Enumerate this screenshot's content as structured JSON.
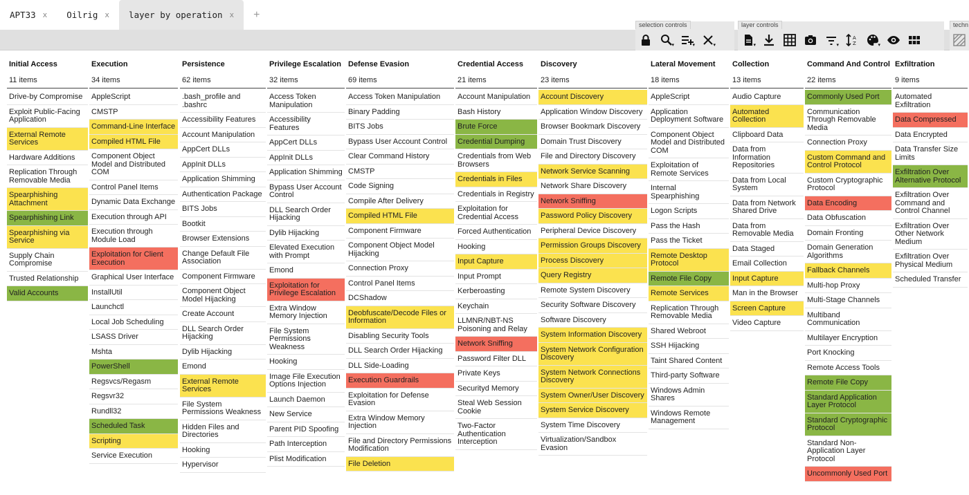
{
  "tabs": [
    {
      "label": "APT33",
      "close": "x"
    },
    {
      "label": "Oilrig",
      "close": "x"
    },
    {
      "label": "layer by operation",
      "close": "x"
    }
  ],
  "tab_add": "+",
  "toolbar": {
    "selection_label": "selection controls",
    "layer_label": "layer controls",
    "technique_label": "techn"
  },
  "colors": {
    "yellow": "#fbe24f",
    "green": "#8ab645",
    "red": "#f46f5f"
  },
  "icons": {
    "selection": [
      "lock-icon",
      "search-icon",
      "select-multiple-icon",
      "clear-icon"
    ],
    "layer": [
      "export-icon",
      "download-icon",
      "grid-icon",
      "camera-icon",
      "filter-icon",
      "sort-icon",
      "palette-icon",
      "eye-icon",
      "view-mode-icon"
    ],
    "technique": [
      "disable-icon"
    ]
  },
  "tactics": [
    {
      "name": "Initial Access",
      "count": "11 items",
      "techniques": [
        [
          "Drive-by Compromise",
          ""
        ],
        [
          "Exploit Public-Facing Application",
          ""
        ],
        [
          "External Remote Services",
          "y"
        ],
        [
          "Hardware Additions",
          ""
        ],
        [
          "Replication Through Removable Media",
          ""
        ],
        [
          "Spearphishing Attachment",
          "y"
        ],
        [
          "Spearphishing Link",
          "g"
        ],
        [
          "Spearphishing via Service",
          "y"
        ],
        [
          "Supply Chain Compromise",
          ""
        ],
        [
          "Trusted Relationship",
          ""
        ],
        [
          "Valid Accounts",
          "g"
        ]
      ]
    },
    {
      "name": "Execution",
      "count": "34 items",
      "techniques": [
        [
          "AppleScript",
          ""
        ],
        [
          "CMSTP",
          ""
        ],
        [
          "Command-Line Interface",
          "y"
        ],
        [
          "Compiled HTML File",
          "y"
        ],
        [
          "Component Object Model and Distributed COM",
          ""
        ],
        [
          "Control Panel Items",
          ""
        ],
        [
          "Dynamic Data Exchange",
          ""
        ],
        [
          "Execution through API",
          ""
        ],
        [
          "Execution through Module Load",
          ""
        ],
        [
          "Exploitation for Client Execution",
          "r"
        ],
        [
          "Graphical User Interface",
          ""
        ],
        [
          "InstallUtil",
          ""
        ],
        [
          "Launchctl",
          ""
        ],
        [
          "Local Job Scheduling",
          ""
        ],
        [
          "LSASS Driver",
          ""
        ],
        [
          "Mshta",
          ""
        ],
        [
          "PowerShell",
          "g"
        ],
        [
          "Regsvcs/Regasm",
          ""
        ],
        [
          "Regsvr32",
          ""
        ],
        [
          "Rundll32",
          ""
        ],
        [
          "Scheduled Task",
          "g"
        ],
        [
          "Scripting",
          "y"
        ],
        [
          "Service Execution",
          ""
        ]
      ]
    },
    {
      "name": "Persistence",
      "count": "62 items",
      "techniques": [
        [
          ".bash_profile and .bashrc",
          ""
        ],
        [
          "Accessibility Features",
          ""
        ],
        [
          "Account Manipulation",
          ""
        ],
        [
          "AppCert DLLs",
          ""
        ],
        [
          "AppInit DLLs",
          ""
        ],
        [
          "Application Shimming",
          ""
        ],
        [
          "Authentication Package",
          ""
        ],
        [
          "BITS Jobs",
          ""
        ],
        [
          "Bootkit",
          ""
        ],
        [
          "Browser Extensions",
          ""
        ],
        [
          "Change Default File Association",
          ""
        ],
        [
          "Component Firmware",
          ""
        ],
        [
          "Component Object Model Hijacking",
          ""
        ],
        [
          "Create Account",
          ""
        ],
        [
          "DLL Search Order Hijacking",
          ""
        ],
        [
          "Dylib Hijacking",
          ""
        ],
        [
          "Emond",
          ""
        ],
        [
          "External Remote Services",
          "y"
        ],
        [
          "File System Permissions Weakness",
          ""
        ],
        [
          "Hidden Files and Directories",
          ""
        ],
        [
          "Hooking",
          ""
        ],
        [
          "Hypervisor",
          ""
        ]
      ]
    },
    {
      "name": "Privilege Escalation",
      "count": "32 items",
      "techniques": [
        [
          "Access Token Manipulation",
          ""
        ],
        [
          "Accessibility Features",
          ""
        ],
        [
          "AppCert DLLs",
          ""
        ],
        [
          "AppInit DLLs",
          ""
        ],
        [
          "Application Shimming",
          ""
        ],
        [
          "Bypass User Account Control",
          ""
        ],
        [
          "DLL Search Order Hijacking",
          ""
        ],
        [
          "Dylib Hijacking",
          ""
        ],
        [
          "Elevated Execution with Prompt",
          ""
        ],
        [
          "Emond",
          ""
        ],
        [
          "Exploitation for Privilege Escalation",
          "r"
        ],
        [
          "Extra Window Memory Injection",
          ""
        ],
        [
          "File System Permissions Weakness",
          ""
        ],
        [
          "Hooking",
          ""
        ],
        [
          "Image File Execution Options Injection",
          ""
        ],
        [
          "Launch Daemon",
          ""
        ],
        [
          "New Service",
          ""
        ],
        [
          "Parent PID Spoofing",
          ""
        ],
        [
          "Path Interception",
          ""
        ],
        [
          "Plist Modification",
          ""
        ]
      ]
    },
    {
      "name": "Defense Evasion",
      "count": "69 items",
      "techniques": [
        [
          "Access Token Manipulation",
          ""
        ],
        [
          "Binary Padding",
          ""
        ],
        [
          "BITS Jobs",
          ""
        ],
        [
          "Bypass User Account Control",
          ""
        ],
        [
          "Clear Command History",
          ""
        ],
        [
          "CMSTP",
          ""
        ],
        [
          "Code Signing",
          ""
        ],
        [
          "Compile After Delivery",
          ""
        ],
        [
          "Compiled HTML File",
          "y"
        ],
        [
          "Component Firmware",
          ""
        ],
        [
          "Component Object Model Hijacking",
          ""
        ],
        [
          "Connection Proxy",
          ""
        ],
        [
          "Control Panel Items",
          ""
        ],
        [
          "DCShadow",
          ""
        ],
        [
          "Deobfuscate/Decode Files or Information",
          "y"
        ],
        [
          "Disabling Security Tools",
          ""
        ],
        [
          "DLL Search Order Hijacking",
          ""
        ],
        [
          "DLL Side-Loading",
          ""
        ],
        [
          "Execution Guardrails",
          "r"
        ],
        [
          "Exploitation for Defense Evasion",
          ""
        ],
        [
          "Extra Window Memory Injection",
          ""
        ],
        [
          "File and Directory Permissions Modification",
          ""
        ],
        [
          "File Deletion",
          "y"
        ]
      ]
    },
    {
      "name": "Credential Access",
      "count": "21 items",
      "techniques": [
        [
          "Account Manipulation",
          ""
        ],
        [
          "Bash History",
          ""
        ],
        [
          "Brute Force",
          "g"
        ],
        [
          "Credential Dumping",
          "g"
        ],
        [
          "Credentials from Web Browsers",
          ""
        ],
        [
          "Credentials in Files",
          "y"
        ],
        [
          "Credentials in Registry",
          ""
        ],
        [
          "Exploitation for Credential Access",
          ""
        ],
        [
          "Forced Authentication",
          ""
        ],
        [
          "Hooking",
          ""
        ],
        [
          "Input Capture",
          "y"
        ],
        [
          "Input Prompt",
          ""
        ],
        [
          "Kerberoasting",
          ""
        ],
        [
          "Keychain",
          ""
        ],
        [
          "LLMNR/NBT-NS Poisoning and Relay",
          ""
        ],
        [
          "Network Sniffing",
          "r"
        ],
        [
          "Password Filter DLL",
          ""
        ],
        [
          "Private Keys",
          ""
        ],
        [
          "Securityd Memory",
          ""
        ],
        [
          "Steal Web Session Cookie",
          ""
        ],
        [
          "Two-Factor Authentication Interception",
          ""
        ]
      ]
    },
    {
      "name": "Discovery",
      "count": "23 items",
      "techniques": [
        [
          "Account Discovery",
          "y"
        ],
        [
          "Application Window Discovery",
          ""
        ],
        [
          "Browser Bookmark Discovery",
          ""
        ],
        [
          "Domain Trust Discovery",
          ""
        ],
        [
          "File and Directory Discovery",
          ""
        ],
        [
          "Network Service Scanning",
          "y"
        ],
        [
          "Network Share Discovery",
          ""
        ],
        [
          "Network Sniffing",
          "r"
        ],
        [
          "Password Policy Discovery",
          "y"
        ],
        [
          "Peripheral Device Discovery",
          ""
        ],
        [
          "Permission Groups Discovery",
          "y"
        ],
        [
          "Process Discovery",
          "y"
        ],
        [
          "Query Registry",
          "y"
        ],
        [
          "Remote System Discovery",
          ""
        ],
        [
          "Security Software Discovery",
          ""
        ],
        [
          "Software Discovery",
          ""
        ],
        [
          "System Information Discovery",
          "y"
        ],
        [
          "System Network Configuration Discovery",
          "y"
        ],
        [
          "System Network Connections Discovery",
          "y"
        ],
        [
          "System Owner/User Discovery",
          "y"
        ],
        [
          "System Service Discovery",
          "y"
        ],
        [
          "System Time Discovery",
          ""
        ],
        [
          "Virtualization/Sandbox Evasion",
          ""
        ]
      ]
    },
    {
      "name": "Lateral Movement",
      "count": "18 items",
      "techniques": [
        [
          "AppleScript",
          ""
        ],
        [
          "Application Deployment Software",
          ""
        ],
        [
          "Component Object Model and Distributed COM",
          ""
        ],
        [
          "Exploitation of Remote Services",
          ""
        ],
        [
          "Internal Spearphishing",
          ""
        ],
        [
          "Logon Scripts",
          ""
        ],
        [
          "Pass the Hash",
          ""
        ],
        [
          "Pass the Ticket",
          ""
        ],
        [
          "Remote Desktop Protocol",
          "y"
        ],
        [
          "Remote File Copy",
          "g"
        ],
        [
          "Remote Services",
          "y"
        ],
        [
          "Replication Through Removable Media",
          ""
        ],
        [
          "Shared Webroot",
          ""
        ],
        [
          "SSH Hijacking",
          ""
        ],
        [
          "Taint Shared Content",
          ""
        ],
        [
          "Third-party Software",
          ""
        ],
        [
          "Windows Admin Shares",
          ""
        ],
        [
          "Windows Remote Management",
          ""
        ]
      ]
    },
    {
      "name": "Collection",
      "count": "13 items",
      "techniques": [
        [
          "Audio Capture",
          ""
        ],
        [
          "Automated Collection",
          "y"
        ],
        [
          "Clipboard Data",
          ""
        ],
        [
          "Data from Information Repositories",
          ""
        ],
        [
          "Data from Local System",
          ""
        ],
        [
          "Data from Network Shared Drive",
          ""
        ],
        [
          "Data from Removable Media",
          ""
        ],
        [
          "Data Staged",
          ""
        ],
        [
          "Email Collection",
          ""
        ],
        [
          "Input Capture",
          "y"
        ],
        [
          "Man in the Browser",
          ""
        ],
        [
          "Screen Capture",
          "y"
        ],
        [
          "Video Capture",
          ""
        ]
      ]
    },
    {
      "name": "Command And Control",
      "count": "22 items",
      "techniques": [
        [
          "Commonly Used Port",
          "g"
        ],
        [
          "Communication Through Removable Media",
          ""
        ],
        [
          "Connection Proxy",
          ""
        ],
        [
          "Custom Command and Control Protocol",
          "y"
        ],
        [
          "Custom Cryptographic Protocol",
          ""
        ],
        [
          "Data Encoding",
          "r"
        ],
        [
          "Data Obfuscation",
          ""
        ],
        [
          "Domain Fronting",
          ""
        ],
        [
          "Domain Generation Algorithms",
          ""
        ],
        [
          "Fallback Channels",
          "y"
        ],
        [
          "Multi-hop Proxy",
          ""
        ],
        [
          "Multi-Stage Channels",
          ""
        ],
        [
          "Multiband Communication",
          ""
        ],
        [
          "Multilayer Encryption",
          ""
        ],
        [
          "Port Knocking",
          ""
        ],
        [
          "Remote Access Tools",
          ""
        ],
        [
          "Remote File Copy",
          "g"
        ],
        [
          "Standard Application Layer Protocol",
          "g"
        ],
        [
          "Standard Cryptographic Protocol",
          "g"
        ],
        [
          "Standard Non-Application Layer Protocol",
          ""
        ],
        [
          "Uncommonly Used Port",
          "r"
        ]
      ]
    },
    {
      "name": "Exfiltration",
      "count": "9 items",
      "techniques": [
        [
          "Automated Exfiltration",
          ""
        ],
        [
          "Data Compressed",
          "r"
        ],
        [
          "Data Encrypted",
          ""
        ],
        [
          "Data Transfer Size Limits",
          ""
        ],
        [
          "Exfiltration Over Alternative Protocol",
          "g"
        ],
        [
          "Exfiltration Over Command and Control Channel",
          ""
        ],
        [
          "Exfiltration Over Other Network Medium",
          ""
        ],
        [
          "Exfiltration Over Physical Medium",
          ""
        ],
        [
          "Scheduled Transfer",
          ""
        ]
      ]
    }
  ]
}
